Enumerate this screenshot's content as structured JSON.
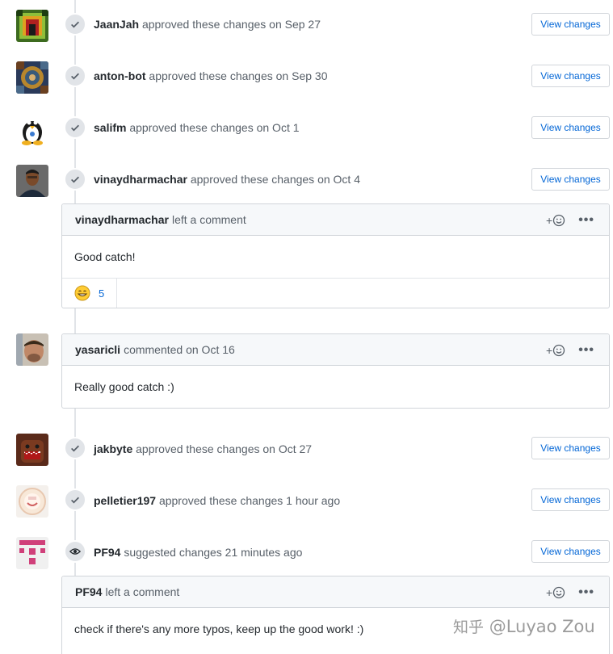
{
  "timeline": {
    "events": [
      {
        "author": "JaanJah",
        "text": "approved these changes on Sep 27",
        "button": "View changes"
      },
      {
        "author": "anton-bot",
        "text": "approved these changes on Sep 30",
        "button": "View changes"
      },
      {
        "author": "salifm",
        "text": "approved these changes on Oct 1",
        "button": "View changes"
      },
      {
        "author": "vinaydharmachar",
        "text": "approved these changes on Oct 4",
        "button": "View changes"
      },
      {
        "author": "jakbyte",
        "text": "approved these changes on Oct 27",
        "button": "View changes"
      },
      {
        "author": "pelletier197",
        "text": "approved these changes 1 hour ago",
        "button": "View changes"
      },
      {
        "author": "PF94",
        "text": "suggested changes 21 minutes ago",
        "button": "View changes"
      }
    ],
    "comments": [
      {
        "author": "vinaydharmachar",
        "header_text": "left a comment",
        "body": "Good catch!",
        "reaction_count": "5",
        "reaction_icon": "grinning-face-icon"
      },
      {
        "author": "yasaricli",
        "header_text": "commented on Oct 16",
        "body": "Really good catch :)"
      },
      {
        "author": "PF94",
        "header_text": "left a comment",
        "body": "check if there's any more typos, keep up the good work! :)"
      }
    ],
    "add_reaction_label": "+",
    "more_label": "•••"
  },
  "watermark": {
    "zh": "知乎",
    "handle": "@Luyao Zou"
  },
  "colors": {
    "link": "#0366d6",
    "border": "#d1d5da",
    "badge": "#e1e4e8",
    "header_bg": "#f6f8fa"
  }
}
